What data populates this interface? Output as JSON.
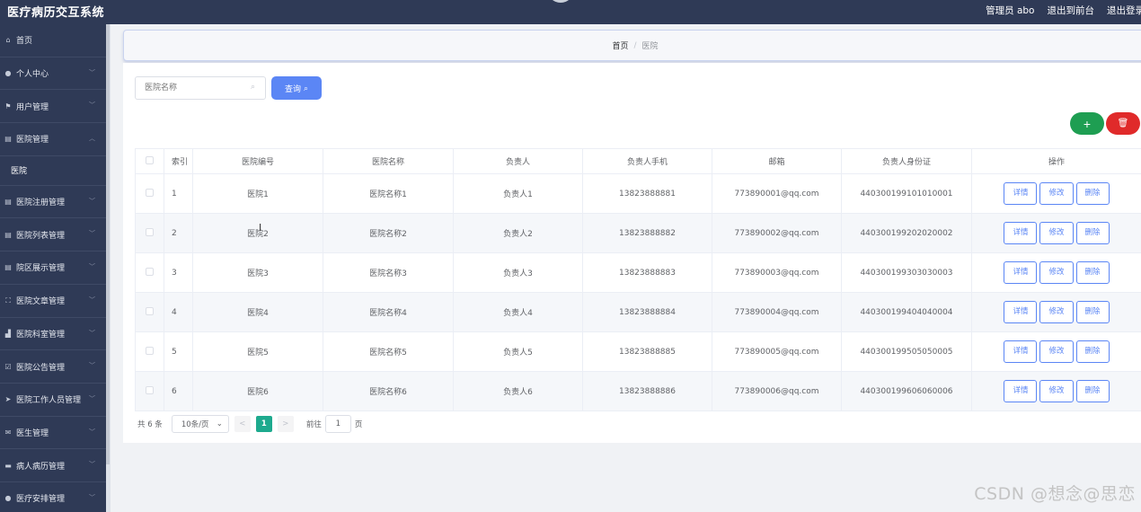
{
  "header": {
    "app_title": "医疗病历交互系统",
    "links": [
      "管理员 abo",
      "退出到前台",
      "退出登录"
    ]
  },
  "sidebar": {
    "items": [
      {
        "label": "首页",
        "icon": "home-icon",
        "glyph": "⌂",
        "chevron": false
      },
      {
        "label": "个人中心",
        "icon": "user-icon",
        "glyph": "●",
        "chevron": true
      },
      {
        "label": "用户管理",
        "icon": "flag-icon",
        "glyph": "⚑",
        "chevron": true
      },
      {
        "label": "医院管理",
        "icon": "document-icon",
        "glyph": "▤",
        "chevron": true,
        "expanded": true
      },
      {
        "label": "医院注册管理",
        "icon": "document-icon",
        "glyph": "▤",
        "chevron": true
      },
      {
        "label": "医院列表管理",
        "icon": "document-icon",
        "glyph": "▤",
        "chevron": true
      },
      {
        "label": "院区展示管理",
        "icon": "document-icon",
        "glyph": "▤",
        "chevron": true
      },
      {
        "label": "医院文章管理",
        "icon": "fullscreen-icon",
        "glyph": "⛶",
        "chevron": true
      },
      {
        "label": "医院科室管理",
        "icon": "chart-icon",
        "glyph": "▟",
        "chevron": true
      },
      {
        "label": "医院公告管理",
        "icon": "checkbox-icon",
        "glyph": "☑",
        "chevron": true
      },
      {
        "label": "医院工作人员管理",
        "icon": "send-icon",
        "glyph": "➤",
        "chevron": true
      },
      {
        "label": "医生管理",
        "icon": "mail-icon",
        "glyph": "✉",
        "chevron": true
      },
      {
        "label": "病人病历管理",
        "icon": "document-icon",
        "glyph": "▬",
        "chevron": true
      },
      {
        "label": "医疗安排管理",
        "icon": "location-icon",
        "glyph": "●",
        "chevron": true
      }
    ],
    "sub_item": "医院"
  },
  "breadcrumb": {
    "home": "首页",
    "separator": "/",
    "current": "医院"
  },
  "search": {
    "placeholder": "医院名称",
    "query_label": "查询"
  },
  "toolbar": {
    "add_glyph": "+",
    "delete_glyph": "🗑"
  },
  "table": {
    "columns": [
      "索引",
      "医院编号",
      "医院名称",
      "负责人",
      "负责人手机",
      "邮箱",
      "负责人身份证",
      "操作"
    ],
    "actions": [
      "详情",
      "修改",
      "删除"
    ],
    "rows": [
      {
        "index": "1",
        "code": "医院1",
        "name": "医院名称1",
        "manager": "负责人1",
        "phone": "13823888881",
        "email": "773890001@qq.com",
        "id_card": "440300199101010001"
      },
      {
        "index": "2",
        "code": "医院2",
        "name": "医院名称2",
        "manager": "负责人2",
        "phone": "13823888882",
        "email": "773890002@qq.com",
        "id_card": "440300199202020002"
      },
      {
        "index": "3",
        "code": "医院3",
        "name": "医院名称3",
        "manager": "负责人3",
        "phone": "13823888883",
        "email": "773890003@qq.com",
        "id_card": "440300199303030003"
      },
      {
        "index": "4",
        "code": "医院4",
        "name": "医院名称4",
        "manager": "负责人4",
        "phone": "13823888884",
        "email": "773890004@qq.com",
        "id_card": "440300199404040004"
      },
      {
        "index": "5",
        "code": "医院5",
        "name": "医院名称5",
        "manager": "负责人5",
        "phone": "13823888885",
        "email": "773890005@qq.com",
        "id_card": "440300199505050005"
      },
      {
        "index": "6",
        "code": "医院6",
        "name": "医院名称6",
        "manager": "负责人6",
        "phone": "13823888886",
        "email": "773890006@qq.com",
        "id_card": "440300199606060006"
      }
    ]
  },
  "pagination": {
    "total": "共 6 条",
    "page_size": "10条/页",
    "prev": "<",
    "current_page": "1",
    "next": ">",
    "goto_label": "前往",
    "goto_value": "1",
    "goto_suffix": "页"
  },
  "watermark": "CSDN @想念@思恋"
}
